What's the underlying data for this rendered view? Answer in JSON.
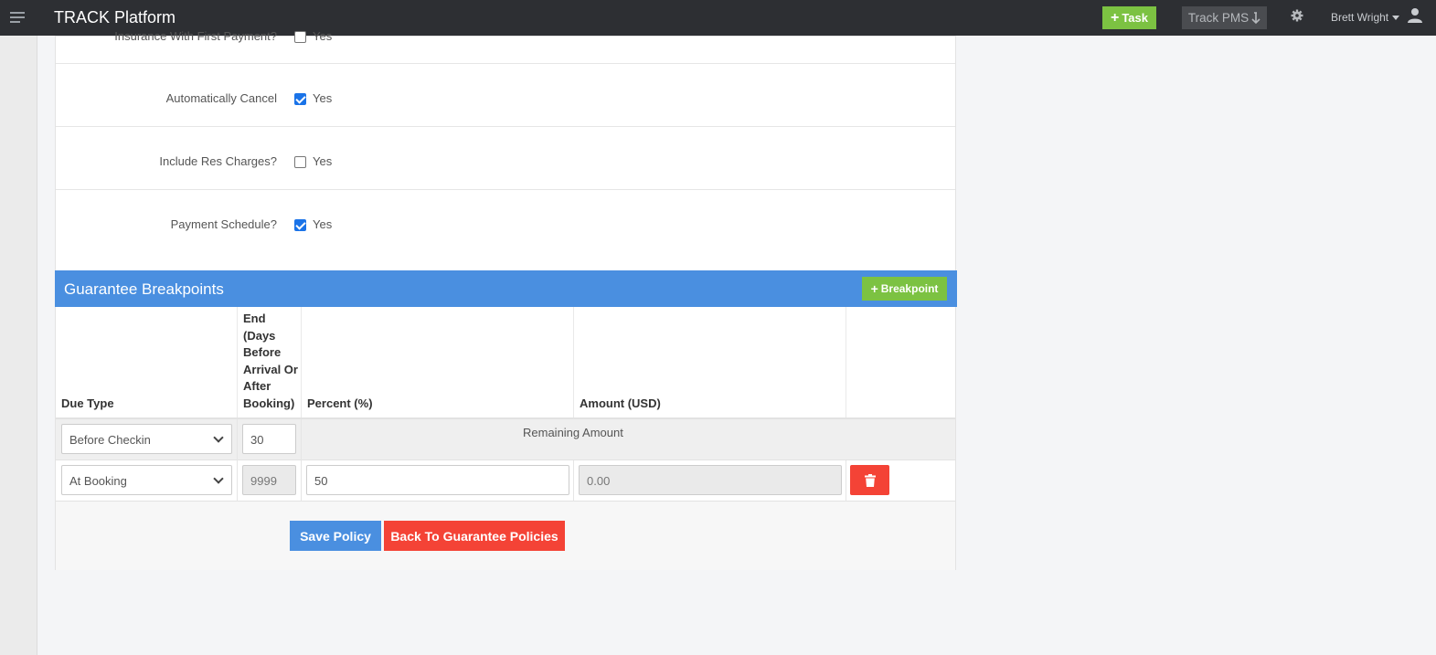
{
  "topbar": {
    "title": "TRACK Platform",
    "task_label": "Task",
    "trackpms_label": "Track PMS",
    "user_name": "Brett Wright"
  },
  "form": {
    "rows": [
      {
        "label": "Insurance With First Payment?",
        "checked": false,
        "value_label": "Yes"
      },
      {
        "label": "Automatically Cancel",
        "checked": true,
        "value_label": "Yes"
      },
      {
        "label": "Include Res Charges?",
        "checked": false,
        "value_label": "Yes"
      },
      {
        "label": "Payment Schedule?",
        "checked": true,
        "value_label": "Yes"
      }
    ]
  },
  "breakpoints": {
    "title": "Guarantee Breakpoints",
    "add_label": "Breakpoint",
    "columns": {
      "due_type": "Due Type",
      "end_days": "End (Days Before Arrival Or After Booking)",
      "percent": "Percent (%)",
      "amount": "Amount (USD)"
    },
    "rows": [
      {
        "due_type": "Before Checkin",
        "end_days": "30",
        "remaining": "Remaining Amount"
      },
      {
        "due_type": "At Booking",
        "end_days": "9999",
        "percent": "50",
        "amount": "0.00"
      }
    ]
  },
  "actions": {
    "save": "Save Policy",
    "back": "Back To Guarantee Policies"
  },
  "colors": {
    "topbar": "#2d2f33",
    "primary": "#4a8fe0",
    "success": "#7cc242",
    "danger": "#f44336"
  }
}
